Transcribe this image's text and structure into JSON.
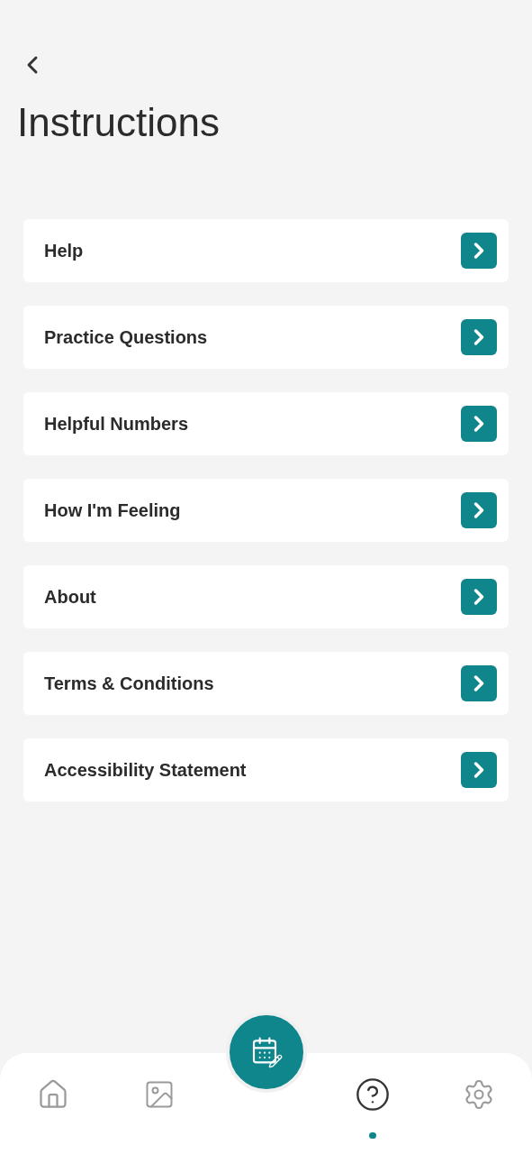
{
  "header": {
    "title": "Instructions"
  },
  "menu": [
    {
      "label": "Help"
    },
    {
      "label": "Practice Questions"
    },
    {
      "label": "Helpful Numbers"
    },
    {
      "label": "How I'm Feeling"
    },
    {
      "label": "About"
    },
    {
      "label": "Terms & Conditions"
    },
    {
      "label": "Accessibility Statement"
    }
  ],
  "bottom_nav": [
    {
      "kind": "home",
      "selected": false
    },
    {
      "kind": "gallery",
      "selected": false
    },
    {
      "kind": "calendar",
      "selected": false
    },
    {
      "kind": "help",
      "selected": true
    },
    {
      "kind": "settings",
      "selected": false
    }
  ]
}
